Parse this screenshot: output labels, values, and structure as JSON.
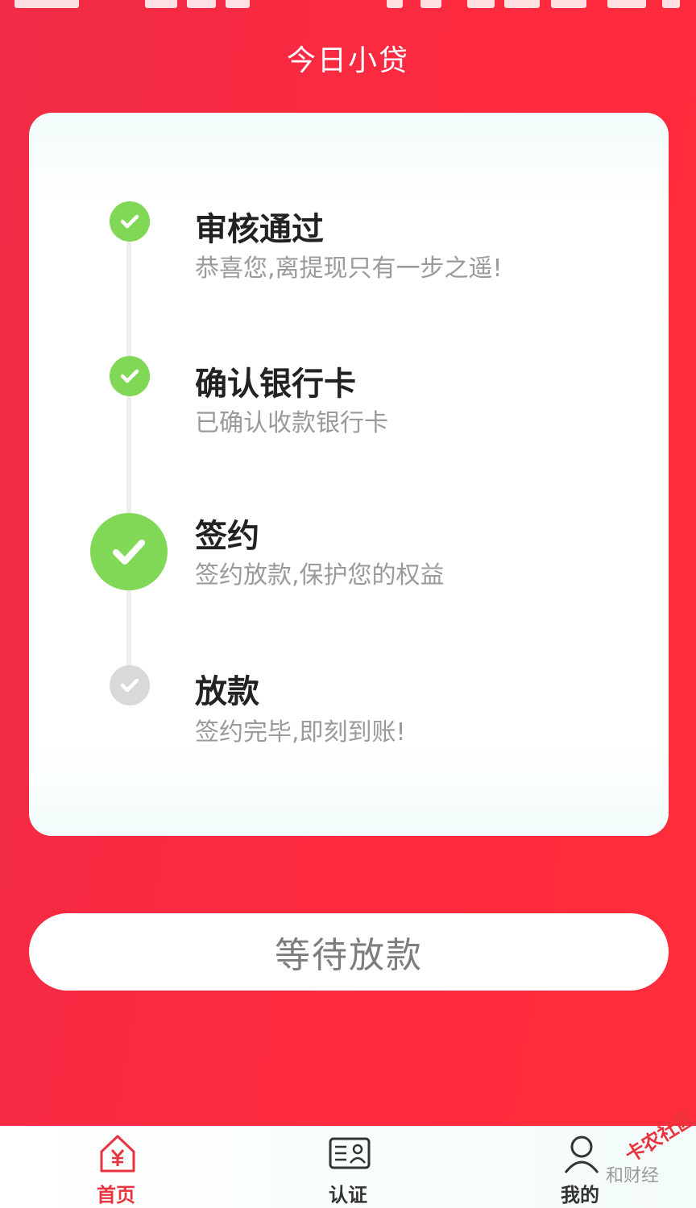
{
  "app_title": "今日小贷",
  "steps": [
    {
      "title": "审核通过",
      "desc": "恭喜您,离提现只有一步之遥!",
      "status": "done",
      "icon": "check-icon"
    },
    {
      "title": "确认银行卡",
      "desc": "已确认收款银行卡",
      "status": "done",
      "icon": "check-icon"
    },
    {
      "title": "签约",
      "desc": "签约放款,保护您的权益",
      "status": "current",
      "icon": "check-icon"
    },
    {
      "title": "放款",
      "desc": "签约完毕,即刻到账!",
      "status": "pending",
      "icon": "check-icon"
    }
  ],
  "action_button": {
    "label": "等待放款"
  },
  "tabbar": {
    "items": [
      {
        "label": "首页",
        "icon": "home-yen-icon",
        "active": true
      },
      {
        "label": "认证",
        "icon": "id-card-icon",
        "active": false
      },
      {
        "label": "我的",
        "icon": "user-icon",
        "active": false
      }
    ]
  },
  "watermark": {
    "text": "卡农社区",
    "subtext": "和财经"
  },
  "colors": {
    "background": "#ff2a3e",
    "step_done": "#80d856",
    "step_pending": "#d9d9d9",
    "tab_active": "#e8343f",
    "tab_inactive": "#333333"
  }
}
